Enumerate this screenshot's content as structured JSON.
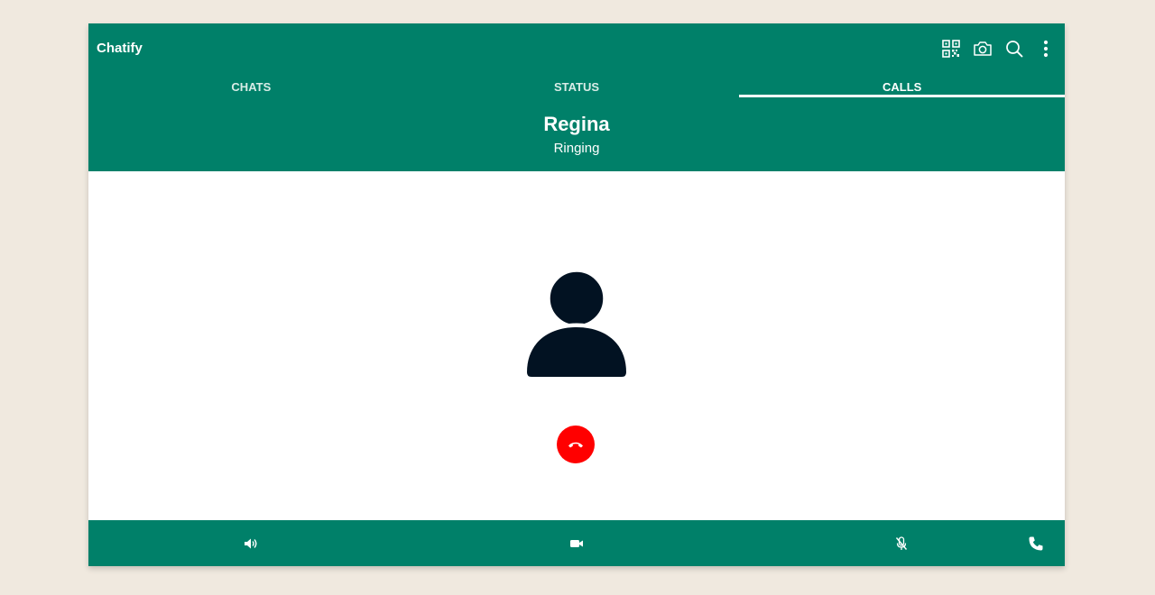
{
  "app": {
    "title": "Chatify",
    "brand_color": "#008069"
  },
  "toolbar": {
    "icons": [
      "qr-code-icon",
      "camera-icon",
      "search-icon",
      "more-vert-icon"
    ]
  },
  "tabs": [
    {
      "label": "CHATS",
      "active": false
    },
    {
      "label": "STATUS",
      "active": false
    },
    {
      "label": "CALLS",
      "active": true
    }
  ],
  "call": {
    "name": "Regina",
    "status": "Ringing",
    "avatar_icon": "person-avatar-icon",
    "end_button_color": "#ff0000"
  },
  "controls": {
    "icons": [
      "speaker-icon",
      "video-icon",
      "mic-off-icon",
      "phone-icon"
    ]
  }
}
